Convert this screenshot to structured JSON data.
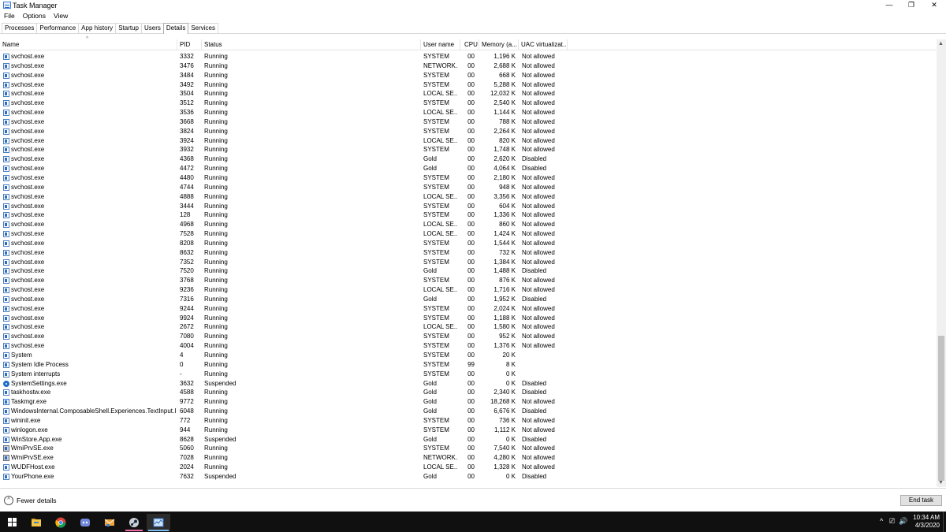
{
  "window": {
    "title": "Task Manager",
    "min": "—",
    "max": "❐",
    "close": "✕"
  },
  "menu": [
    "File",
    "Options",
    "View"
  ],
  "tabs": [
    "Processes",
    "Performance",
    "App history",
    "Startup",
    "Users",
    "Details",
    "Services"
  ],
  "active_tab": "Details",
  "columns": {
    "name": "Name",
    "pid": "PID",
    "status": "Status",
    "user": "User name",
    "cpu": "CPU",
    "memory": "Memory (a...",
    "uac": "UAC virtualizat..."
  },
  "sort_indicator": "^",
  "rows": [
    {
      "name": "svchost.exe",
      "pid": "3332",
      "status": "Running",
      "user": "SYSTEM",
      "cpu": "00",
      "mem": "1,196 K",
      "uac": "Not allowed",
      "icon": "service-icon"
    },
    {
      "name": "svchost.exe",
      "pid": "3476",
      "status": "Running",
      "user": "NETWORK...",
      "cpu": "00",
      "mem": "2,688 K",
      "uac": "Not allowed",
      "icon": "service-icon"
    },
    {
      "name": "svchost.exe",
      "pid": "3484",
      "status": "Running",
      "user": "SYSTEM",
      "cpu": "00",
      "mem": "668 K",
      "uac": "Not allowed",
      "icon": "service-icon"
    },
    {
      "name": "svchost.exe",
      "pid": "3492",
      "status": "Running",
      "user": "SYSTEM",
      "cpu": "00",
      "mem": "5,288 K",
      "uac": "Not allowed",
      "icon": "service-icon"
    },
    {
      "name": "svchost.exe",
      "pid": "3504",
      "status": "Running",
      "user": "LOCAL SE...",
      "cpu": "00",
      "mem": "12,032 K",
      "uac": "Not allowed",
      "icon": "service-icon"
    },
    {
      "name": "svchost.exe",
      "pid": "3512",
      "status": "Running",
      "user": "SYSTEM",
      "cpu": "00",
      "mem": "2,540 K",
      "uac": "Not allowed",
      "icon": "service-icon"
    },
    {
      "name": "svchost.exe",
      "pid": "3536",
      "status": "Running",
      "user": "LOCAL SE...",
      "cpu": "00",
      "mem": "1,144 K",
      "uac": "Not allowed",
      "icon": "service-icon"
    },
    {
      "name": "svchost.exe",
      "pid": "3668",
      "status": "Running",
      "user": "SYSTEM",
      "cpu": "00",
      "mem": "788 K",
      "uac": "Not allowed",
      "icon": "service-icon"
    },
    {
      "name": "svchost.exe",
      "pid": "3824",
      "status": "Running",
      "user": "SYSTEM",
      "cpu": "00",
      "mem": "2,264 K",
      "uac": "Not allowed",
      "icon": "service-icon"
    },
    {
      "name": "svchost.exe",
      "pid": "3924",
      "status": "Running",
      "user": "LOCAL SE...",
      "cpu": "00",
      "mem": "820 K",
      "uac": "Not allowed",
      "icon": "service-icon"
    },
    {
      "name": "svchost.exe",
      "pid": "3932",
      "status": "Running",
      "user": "SYSTEM",
      "cpu": "00",
      "mem": "1,748 K",
      "uac": "Not allowed",
      "icon": "service-icon"
    },
    {
      "name": "svchost.exe",
      "pid": "4368",
      "status": "Running",
      "user": "Gold",
      "cpu": "00",
      "mem": "2,620 K",
      "uac": "Disabled",
      "icon": "service-icon"
    },
    {
      "name": "svchost.exe",
      "pid": "4472",
      "status": "Running",
      "user": "Gold",
      "cpu": "00",
      "mem": "4,064 K",
      "uac": "Disabled",
      "icon": "service-icon"
    },
    {
      "name": "svchost.exe",
      "pid": "4480",
      "status": "Running",
      "user": "SYSTEM",
      "cpu": "00",
      "mem": "2,180 K",
      "uac": "Not allowed",
      "icon": "service-icon"
    },
    {
      "name": "svchost.exe",
      "pid": "4744",
      "status": "Running",
      "user": "SYSTEM",
      "cpu": "00",
      "mem": "948 K",
      "uac": "Not allowed",
      "icon": "service-icon"
    },
    {
      "name": "svchost.exe",
      "pid": "4888",
      "status": "Running",
      "user": "LOCAL SE...",
      "cpu": "00",
      "mem": "3,356 K",
      "uac": "Not allowed",
      "icon": "service-icon"
    },
    {
      "name": "svchost.exe",
      "pid": "3444",
      "status": "Running",
      "user": "SYSTEM",
      "cpu": "00",
      "mem": "604 K",
      "uac": "Not allowed",
      "icon": "service-icon"
    },
    {
      "name": "svchost.exe",
      "pid": "128",
      "status": "Running",
      "user": "SYSTEM",
      "cpu": "00",
      "mem": "1,336 K",
      "uac": "Not allowed",
      "icon": "service-icon"
    },
    {
      "name": "svchost.exe",
      "pid": "4968",
      "status": "Running",
      "user": "LOCAL SE...",
      "cpu": "00",
      "mem": "860 K",
      "uac": "Not allowed",
      "icon": "service-icon"
    },
    {
      "name": "svchost.exe",
      "pid": "7528",
      "status": "Running",
      "user": "LOCAL SE...",
      "cpu": "00",
      "mem": "1,424 K",
      "uac": "Not allowed",
      "icon": "service-icon"
    },
    {
      "name": "svchost.exe",
      "pid": "8208",
      "status": "Running",
      "user": "SYSTEM",
      "cpu": "00",
      "mem": "1,544 K",
      "uac": "Not allowed",
      "icon": "service-icon"
    },
    {
      "name": "svchost.exe",
      "pid": "8632",
      "status": "Running",
      "user": "SYSTEM",
      "cpu": "00",
      "mem": "732 K",
      "uac": "Not allowed",
      "icon": "service-icon"
    },
    {
      "name": "svchost.exe",
      "pid": "7352",
      "status": "Running",
      "user": "SYSTEM",
      "cpu": "00",
      "mem": "1,384 K",
      "uac": "Not allowed",
      "icon": "service-icon"
    },
    {
      "name": "svchost.exe",
      "pid": "7520",
      "status": "Running",
      "user": "Gold",
      "cpu": "00",
      "mem": "1,488 K",
      "uac": "Disabled",
      "icon": "service-icon"
    },
    {
      "name": "svchost.exe",
      "pid": "3768",
      "status": "Running",
      "user": "SYSTEM",
      "cpu": "00",
      "mem": "876 K",
      "uac": "Not allowed",
      "icon": "service-icon"
    },
    {
      "name": "svchost.exe",
      "pid": "9236",
      "status": "Running",
      "user": "LOCAL SE...",
      "cpu": "00",
      "mem": "1,716 K",
      "uac": "Not allowed",
      "icon": "service-icon"
    },
    {
      "name": "svchost.exe",
      "pid": "7316",
      "status": "Running",
      "user": "Gold",
      "cpu": "00",
      "mem": "1,952 K",
      "uac": "Disabled",
      "icon": "service-icon"
    },
    {
      "name": "svchost.exe",
      "pid": "9244",
      "status": "Running",
      "user": "SYSTEM",
      "cpu": "00",
      "mem": "2,024 K",
      "uac": "Not allowed",
      "icon": "service-icon"
    },
    {
      "name": "svchost.exe",
      "pid": "9924",
      "status": "Running",
      "user": "SYSTEM",
      "cpu": "00",
      "mem": "1,188 K",
      "uac": "Not allowed",
      "icon": "service-icon"
    },
    {
      "name": "svchost.exe",
      "pid": "2672",
      "status": "Running",
      "user": "LOCAL SE...",
      "cpu": "00",
      "mem": "1,580 K",
      "uac": "Not allowed",
      "icon": "service-icon"
    },
    {
      "name": "svchost.exe",
      "pid": "7080",
      "status": "Running",
      "user": "SYSTEM",
      "cpu": "00",
      "mem": "952 K",
      "uac": "Not allowed",
      "icon": "service-icon"
    },
    {
      "name": "svchost.exe",
      "pid": "4004",
      "status": "Running",
      "user": "SYSTEM",
      "cpu": "00",
      "mem": "1,376 K",
      "uac": "Not allowed",
      "icon": "service-icon"
    },
    {
      "name": "System",
      "pid": "4",
      "status": "Running",
      "user": "SYSTEM",
      "cpu": "00",
      "mem": "20 K",
      "uac": "",
      "icon": "process-icon"
    },
    {
      "name": "System Idle Process",
      "pid": "0",
      "status": "Running",
      "user": "SYSTEM",
      "cpu": "99",
      "mem": "8 K",
      "uac": "",
      "icon": "process-icon"
    },
    {
      "name": "System interrupts",
      "pid": "-",
      "status": "Running",
      "user": "SYSTEM",
      "cpu": "00",
      "mem": "0 K",
      "uac": "",
      "icon": "process-icon"
    },
    {
      "name": "SystemSettings.exe",
      "pid": "3632",
      "status": "Suspended",
      "user": "Gold",
      "cpu": "00",
      "mem": "0 K",
      "uac": "Disabled",
      "icon": "settings-gear-icon"
    },
    {
      "name": "taskhostw.exe",
      "pid": "4588",
      "status": "Running",
      "user": "Gold",
      "cpu": "00",
      "mem": "2,340 K",
      "uac": "Disabled",
      "icon": "process-icon"
    },
    {
      "name": "Taskmgr.exe",
      "pid": "9772",
      "status": "Running",
      "user": "Gold",
      "cpu": "00",
      "mem": "18,268 K",
      "uac": "Not allowed",
      "icon": "task-manager-icon"
    },
    {
      "name": "WindowsInternal.ComposableShell.Experiences.TextInput.Inp...",
      "pid": "6048",
      "status": "Running",
      "user": "Gold",
      "cpu": "00",
      "mem": "6,676 K",
      "uac": "Disabled",
      "icon": "process-icon"
    },
    {
      "name": "wininit.exe",
      "pid": "772",
      "status": "Running",
      "user": "SYSTEM",
      "cpu": "00",
      "mem": "736 K",
      "uac": "Not allowed",
      "icon": "process-icon"
    },
    {
      "name": "winlogon.exe",
      "pid": "944",
      "status": "Running",
      "user": "SYSTEM",
      "cpu": "00",
      "mem": "1,112 K",
      "uac": "Not allowed",
      "icon": "process-icon"
    },
    {
      "name": "WinStore.App.exe",
      "pid": "8628",
      "status": "Suspended",
      "user": "Gold",
      "cpu": "00",
      "mem": "0 K",
      "uac": "Disabled",
      "icon": "process-icon"
    },
    {
      "name": "WmiPrvSE.exe",
      "pid": "5060",
      "status": "Running",
      "user": "SYSTEM",
      "cpu": "00",
      "mem": "7,540 K",
      "uac": "Not allowed",
      "icon": "wmi-icon"
    },
    {
      "name": "WmiPrvSE.exe",
      "pid": "7028",
      "status": "Running",
      "user": "NETWORK...",
      "cpu": "00",
      "mem": "4,280 K",
      "uac": "Not allowed",
      "icon": "wmi-icon"
    },
    {
      "name": "WUDFHost.exe",
      "pid": "2024",
      "status": "Running",
      "user": "LOCAL SE...",
      "cpu": "00",
      "mem": "1,328 K",
      "uac": "Not allowed",
      "icon": "process-icon"
    },
    {
      "name": "YourPhone.exe",
      "pid": "7632",
      "status": "Suspended",
      "user": "Gold",
      "cpu": "00",
      "mem": "0 K",
      "uac": "Disabled",
      "icon": "process-icon"
    }
  ],
  "footer": {
    "fewer_details": "Fewer details",
    "fewer_icon": "^",
    "end_task": "End task"
  },
  "taskbar": {
    "apps": [
      "start-icon",
      "file-explorer-icon",
      "chrome-icon",
      "discord-icon",
      "mail-app-icon",
      "steam-icon",
      "task-manager-icon"
    ],
    "time": "10:34 AM",
    "date": "4/3/2020",
    "tray_chevron": "^",
    "network_glyph": "⎚",
    "volume_glyph": "🔊"
  },
  "colors": {
    "accent": "#0078d7",
    "taskbar": "#101010",
    "scroll_thumb": "#c2c2c2"
  }
}
